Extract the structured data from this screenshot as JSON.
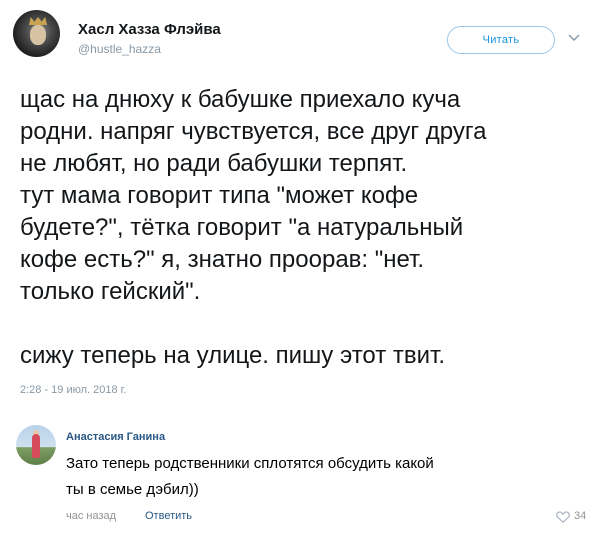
{
  "tweet": {
    "author_name": "Хасл Хазза Флэйва",
    "author_handle": "@hustle_hazza",
    "follow_label": "Читать",
    "text": "щас на днюху к бабушке приехало куча\nродни. напряг чувствуется, все друг друга\nне любят, но ради бабушки терпят.\nтут мама говорит типа \"может кофе\nбудете?\", тётка говорит \"а натуральный\nкофе есть?\" я, знатно проорав: \"нет.\nтолько гейский\".\n\nсижу теперь на улице. пишу этот твит.",
    "timestamp": "2:28 - 19 июл. 2018 г."
  },
  "comment": {
    "author_name": "Анастасия Ганина",
    "text": "Зато теперь родственники сплотятся обсудить какой\nты в семье дэбил))",
    "time": "час назад",
    "reply_label": "Ответить",
    "likes": "34"
  },
  "icons": {
    "follow_menu": "chevron-down-icon",
    "like": "heart-icon"
  },
  "colors": {
    "twitter_blue": "#1b95e0",
    "vk_link": "#2a5885",
    "muted_gray": "#8899a6"
  }
}
